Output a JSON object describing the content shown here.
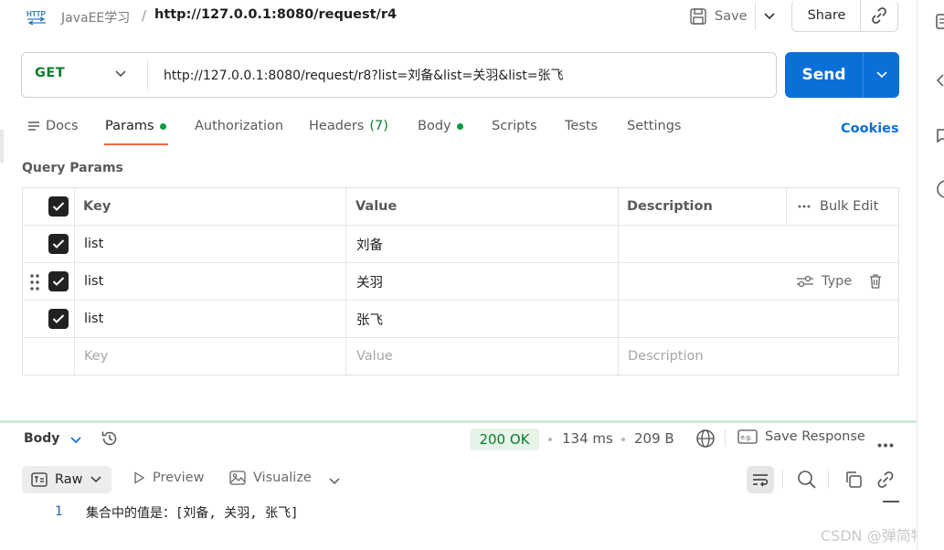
{
  "breadcrumb": {
    "http_badge": "HTTP",
    "collection": "JavaEE学习",
    "separator": "/",
    "request": "http://127.0.0.1:8080/request/r4"
  },
  "toolbar": {
    "save_label": "Save",
    "share_label": "Share"
  },
  "request": {
    "method": "GET",
    "url": "http://127.0.0.1:8080/request/r8?list=刘备&list=关羽&list=张飞",
    "send_label": "Send"
  },
  "tabs": [
    {
      "label": "Docs",
      "active": false,
      "dot": false
    },
    {
      "label": "Params",
      "active": true,
      "dot": true
    },
    {
      "label": "Authorization",
      "active": false,
      "dot": false
    },
    {
      "label": "Headers",
      "count": "(7)",
      "active": false,
      "dot": false
    },
    {
      "label": "Body",
      "active": false,
      "dot": true
    },
    {
      "label": "Scripts",
      "active": false,
      "dot": false
    },
    {
      "label": "Tests",
      "active": false,
      "dot": false
    },
    {
      "label": "Settings",
      "active": false,
      "dot": false
    }
  ],
  "cookies_label": "Cookies",
  "query_params": {
    "title": "Query Params",
    "headers": {
      "key": "Key",
      "value": "Value",
      "description": "Description",
      "bulk_edit": "Bulk Edit"
    },
    "rows": [
      {
        "key": "list",
        "value": "刘备",
        "checked": true
      },
      {
        "key": "list",
        "value": "关羽",
        "checked": true,
        "type_label": "Type"
      },
      {
        "key": "list",
        "value": "张飞",
        "checked": true
      }
    ],
    "placeholders": {
      "key": "Key",
      "value": "Value",
      "description": "Description"
    }
  },
  "response": {
    "body_label": "Body",
    "status": "200 OK",
    "time": "134 ms",
    "size": "209 B",
    "save_response": "Save Response",
    "views": {
      "raw": "Raw",
      "preview": "Preview",
      "visualize": "Visualize"
    },
    "line_number": "1",
    "content": "集合中的值是：[刘备, 关羽, 张飞]"
  },
  "watermark": "CSDN @弹简特",
  "colors": {
    "accent": "#0b6fd8",
    "method_get": "#0a7d2c",
    "active_tab_underline": "#f26b3a",
    "status_ok_bg": "#e6f4ea"
  }
}
